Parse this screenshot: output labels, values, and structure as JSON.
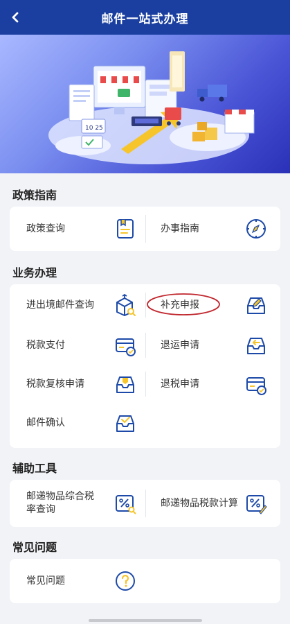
{
  "header": {
    "title": "邮件一站式办理"
  },
  "sections": {
    "policy": {
      "title": "政策指南",
      "items": [
        {
          "label": "政策查询",
          "icon": "document-icon"
        },
        {
          "label": "办事指南",
          "icon": "compass-icon"
        }
      ]
    },
    "business": {
      "title": "业务办理",
      "items": [
        {
          "label": "进出境邮件查询",
          "icon": "package-search-icon"
        },
        {
          "label": "补充申报",
          "icon": "tray-edit-icon",
          "highlighted": true
        },
        {
          "label": "税款支付",
          "icon": "card-check-icon"
        },
        {
          "label": "退运申请",
          "icon": "tray-return-icon"
        },
        {
          "label": "税款复核申请",
          "icon": "tray-check-icon"
        },
        {
          "label": "退税申请",
          "icon": "card-check-icon"
        },
        {
          "label": "邮件确认",
          "icon": "tray-confirm-icon"
        }
      ]
    },
    "tools": {
      "title": "辅助工具",
      "items": [
        {
          "label": "邮递物品综合税率查询",
          "icon": "percent-search-icon"
        },
        {
          "label": "邮递物品税款计算",
          "icon": "percent-calc-icon"
        }
      ]
    },
    "faq": {
      "title": "常见问题",
      "items": [
        {
          "label": "常见问题",
          "icon": "question-icon"
        }
      ]
    }
  },
  "banner": {
    "calendar_text": "10 25"
  },
  "colors": {
    "header": "#1a3fa0",
    "icon": "#1d4aa8",
    "highlight": "#c0262d"
  }
}
